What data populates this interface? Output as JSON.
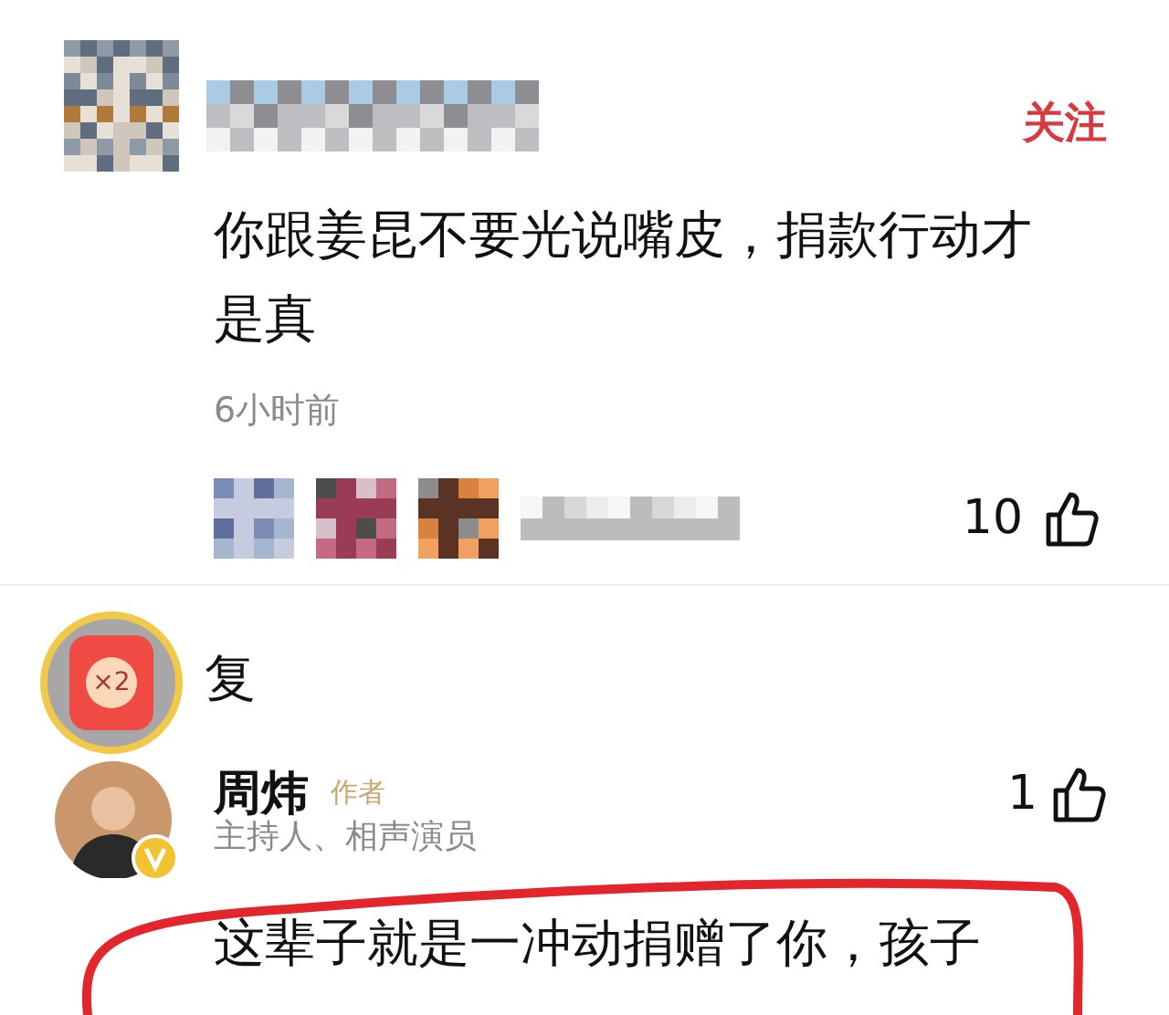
{
  "comment": {
    "follow_label": "关注",
    "text": "你跟姜昆不要光说嘴皮，捐款行动才是真",
    "time": "6小时前",
    "like_count": "10"
  },
  "replies": {
    "header": "复",
    "badge": "×2",
    "items": [
      {
        "name": "周炜",
        "tag": "作者",
        "subtitle": "主持人、相声演员",
        "like_count": "1",
        "verified": true,
        "circled": true,
        "text": "这辈子就是一冲动捐赠了你，孩子"
      }
    ]
  }
}
